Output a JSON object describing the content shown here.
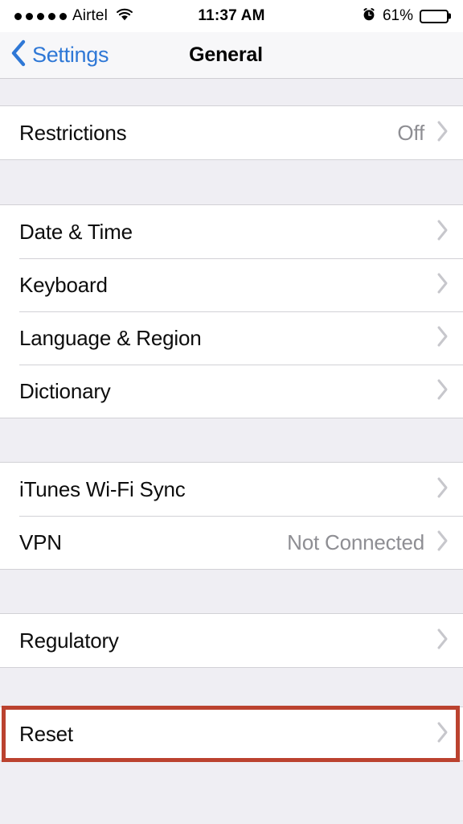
{
  "status_bar": {
    "signal_dots": 5,
    "carrier": "Airtel",
    "wifi_icon": "wifi-icon",
    "time": "11:37 AM",
    "alarm_icon": "alarm-clock-icon",
    "battery_percent": "61%",
    "battery_level": 61
  },
  "nav_bar": {
    "back_icon": "chevron-left-icon",
    "back_label": "Settings",
    "title": "General",
    "tint_color": "#2f78d6"
  },
  "list": {
    "chevron_icon": "chevron-right-icon",
    "groups": [
      {
        "id": "restrictions-group",
        "rows": [
          {
            "label": "Restrictions",
            "value": "Off",
            "accessory": "chevron-right-icon"
          }
        ]
      },
      {
        "id": "locale-group",
        "rows": [
          {
            "label": "Date & Time",
            "value": "",
            "accessory": "chevron-right-icon"
          },
          {
            "label": "Keyboard",
            "value": "",
            "accessory": "chevron-right-icon"
          },
          {
            "label": "Language & Region",
            "value": "",
            "accessory": "chevron-right-icon"
          },
          {
            "label": "Dictionary",
            "value": "",
            "accessory": "chevron-right-icon"
          }
        ]
      },
      {
        "id": "sync-group",
        "rows": [
          {
            "label": "iTunes Wi-Fi Sync",
            "value": "",
            "accessory": "chevron-right-icon"
          },
          {
            "label": "VPN",
            "value": "Not Connected",
            "accessory": "chevron-right-icon"
          }
        ]
      },
      {
        "id": "regulatory-group",
        "rows": [
          {
            "label": "Regulatory",
            "value": "",
            "accessory": "chevron-right-icon"
          }
        ]
      },
      {
        "id": "reset-group",
        "highlighted": true,
        "rows": [
          {
            "label": "Reset",
            "value": "",
            "accessory": "chevron-right-icon"
          }
        ]
      }
    ]
  },
  "annotation": {
    "highlight_color": "#bb422f",
    "target": "Reset"
  },
  "theme": {
    "background": "#efeef3",
    "row_background": "#ffffff",
    "separator": "#d2d1d6",
    "value_text": "#8e8e93",
    "chevron": "#c7c7cc"
  }
}
